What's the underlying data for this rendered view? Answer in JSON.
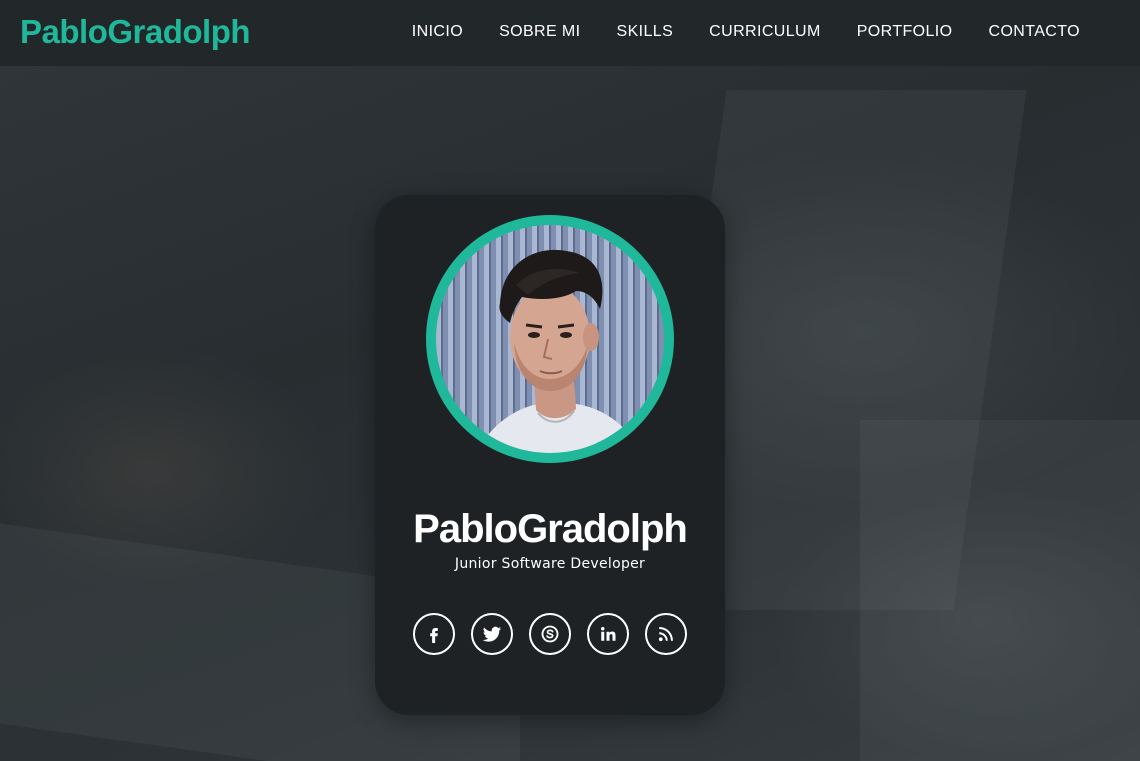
{
  "navbar": {
    "brand": "PabloGradolph",
    "links": [
      {
        "label": "INICIO"
      },
      {
        "label": "SOBRE MI"
      },
      {
        "label": "SKILLS"
      },
      {
        "label": "CURRICULUM"
      },
      {
        "label": "PORTFOLIO"
      },
      {
        "label": "CONTACTO"
      }
    ]
  },
  "profile": {
    "name": "PabloGradolph",
    "role": "Junior Software Developer",
    "avatar_icon": "profile-photo"
  },
  "social": [
    {
      "icon": "facebook-icon"
    },
    {
      "icon": "twitter-icon"
    },
    {
      "icon": "skype-icon"
    },
    {
      "icon": "linkedin-icon"
    },
    {
      "icon": "rss-icon"
    }
  ],
  "colors": {
    "accent": "#1fb89a",
    "navbar_bg": "#22272a",
    "card_bg": "#1e2224",
    "text": "#ffffff"
  }
}
